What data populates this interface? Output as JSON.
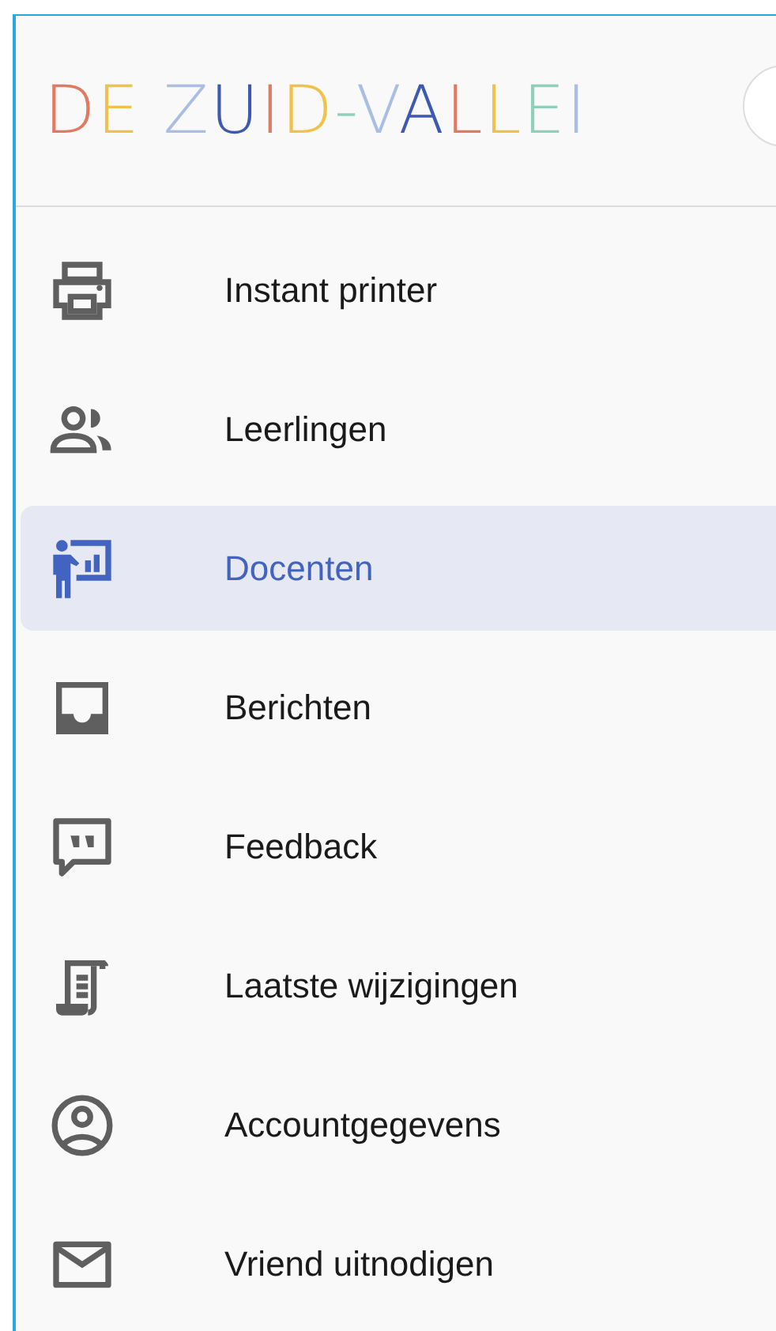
{
  "logo": {
    "text": "DE ZUID-VALLEI"
  },
  "menu": [
    {
      "kind": "printer",
      "label": "Instant printer",
      "selected": false
    },
    {
      "kind": "people",
      "label": "Leerlingen",
      "selected": false
    },
    {
      "kind": "teacher",
      "label": "Docenten",
      "selected": true
    },
    {
      "kind": "inbox",
      "label": "Berichten",
      "selected": false
    },
    {
      "kind": "feedback",
      "label": "Feedback",
      "selected": false
    },
    {
      "kind": "scroll",
      "label": "Laatste wijzigingen",
      "selected": false
    },
    {
      "kind": "account",
      "label": "Accountgegevens",
      "selected": false
    },
    {
      "kind": "mail",
      "label": "Vriend uitnodigen",
      "selected": false
    }
  ]
}
